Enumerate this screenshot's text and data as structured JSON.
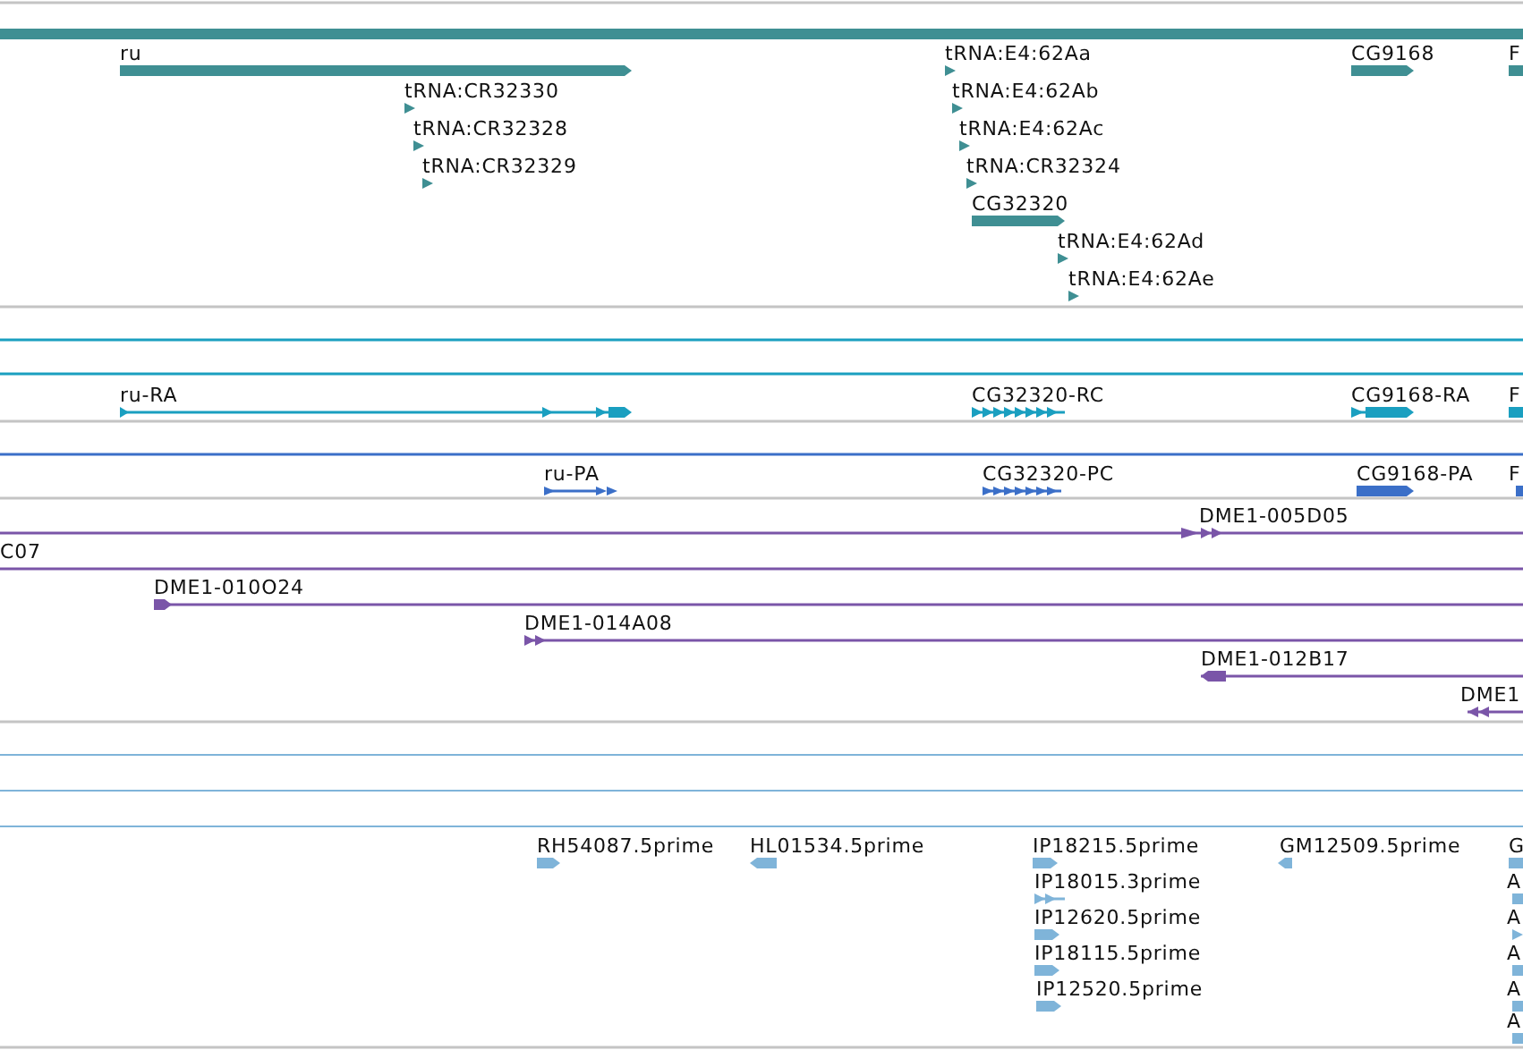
{
  "tracks": [
    {
      "kind": "gene",
      "features": [
        {
          "label": "ru",
          "reverse": false
        },
        {
          "label": "tRNA:CR32330",
          "reverse": false
        },
        {
          "label": "tRNA:CR32328",
          "reverse": false
        },
        {
          "label": "tRNA:CR32329",
          "reverse": false
        },
        {
          "label": "tRNA:E4:62Aa",
          "reverse": false
        },
        {
          "label": "tRNA:E4:62Ab",
          "reverse": false
        },
        {
          "label": "tRNA:E4:62Ac",
          "reverse": false
        },
        {
          "label": "tRNA:CR32324",
          "reverse": false
        },
        {
          "label": "CG32320",
          "reverse": false
        },
        {
          "label": "tRNA:E4:62Ad",
          "reverse": false
        },
        {
          "label": "tRNA:E4:62Ae",
          "reverse": false
        },
        {
          "label": "CG9168",
          "reverse": false
        },
        {
          "label": "F"
        }
      ]
    },
    {
      "kind": "transcript",
      "features": [
        {
          "label": "ru-RA",
          "reverse": false
        },
        {
          "label": "CG32320-RC",
          "reverse": false
        },
        {
          "label": "CG9168-RA",
          "reverse": false
        },
        {
          "label": "F"
        }
      ]
    },
    {
      "kind": "protein",
      "features": [
        {
          "label": "ru-PA",
          "reverse": false
        },
        {
          "label": "CG32320-PC",
          "reverse": false
        },
        {
          "label": "CG9168-PA",
          "reverse": false
        },
        {
          "label": "F"
        }
      ]
    },
    {
      "kind": "clone",
      "features": [
        {
          "label": "DME1-005D05",
          "reverse": false
        },
        {
          "label": "C07"
        },
        {
          "label": "DME1-010O24",
          "reverse": false
        },
        {
          "label": "DME1-014A08",
          "reverse": false
        },
        {
          "label": "DME1-012B17",
          "reverse": true
        },
        {
          "label": "DME1",
          "reverse": true
        }
      ]
    },
    {
      "kind": "est",
      "features": [
        {
          "label": "RH54087.5prime",
          "reverse": false
        },
        {
          "label": "HL01534.5prime",
          "reverse": true
        },
        {
          "label": "IP18215.5prime",
          "reverse": false
        },
        {
          "label": "IP18015.3prime",
          "reverse": false
        },
        {
          "label": "IP12620.5prime",
          "reverse": false
        },
        {
          "label": "IP18115.5prime",
          "reverse": false
        },
        {
          "label": "IP12520.5prime",
          "reverse": false
        },
        {
          "label": "GM12509.5prime",
          "reverse": true
        },
        {
          "label": "G"
        },
        {
          "label": "A"
        },
        {
          "label": "A",
          "reverse": false
        },
        {
          "label": "A"
        },
        {
          "label": "A"
        },
        {
          "label": "A"
        }
      ]
    }
  ]
}
